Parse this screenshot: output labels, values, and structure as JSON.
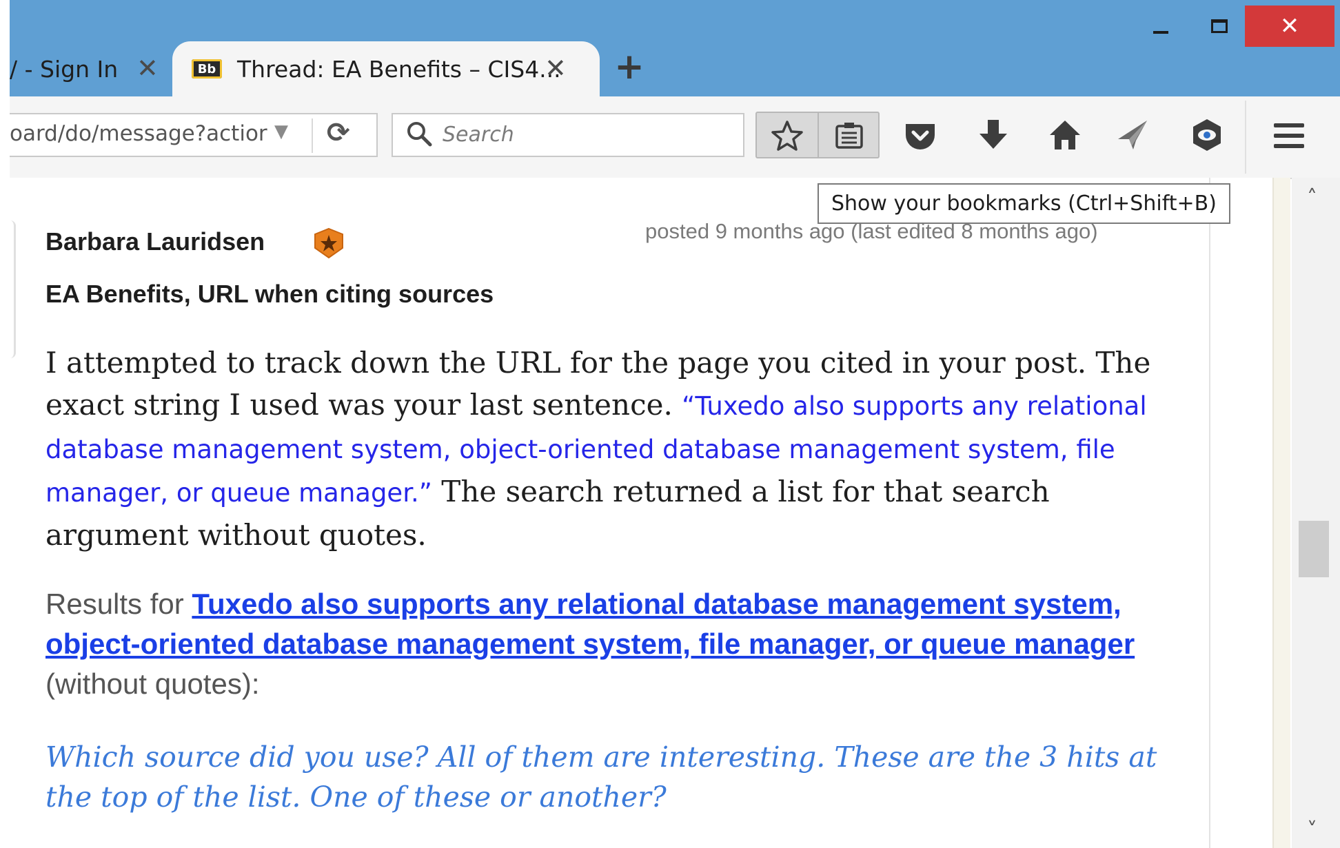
{
  "window": {
    "minimize_label": "–",
    "maximize_label": "☐",
    "close_label": "✕"
  },
  "tabs": [
    {
      "label": "/ - Sign In",
      "close": "✕"
    },
    {
      "label": "Thread: EA Benefits – CIS4...",
      "favicon": "Bb",
      "close": "✕"
    }
  ],
  "new_tab_label": "+",
  "navbar": {
    "url": "oard/do/message?actior",
    "search_placeholder": "Search",
    "icons": [
      "star-icon",
      "bookmarks-icon",
      "pocket-icon",
      "download-icon",
      "home-icon",
      "send-icon",
      "privacy-icon",
      "menu-icon"
    ]
  },
  "tooltip": "Show your bookmarks (Ctrl+Shift+B)",
  "post": {
    "author": "Barbara Lauridsen",
    "posted": "posted 9 months ago (last edited 8 months ago)",
    "subject": "EA Benefits, URL when citing sources",
    "body_intro": "I attempted to track down the URL for the page you cited in your post. The exact string I used was your last sentence. ",
    "body_quote": "“Tuxedo also supports any relational database management system, object-oriented database management system, file manager, or queue manager.”",
    "body_outro": " The search returned a list for that search argument without quotes.",
    "results_prefix": "Results for ",
    "results_link": "Tuxedo also supports any relational database management system, object-oriented database management system, file manager, or queue manager",
    "results_suffix": " (without quotes):",
    "question": "Which source did you use? All of them are interesting. These are the 3 hits at the top of the list. One of these or another?"
  },
  "colors": {
    "titlebar": "#5f9fd3",
    "close_button": "#d3393a",
    "quote_text": "#2525e8",
    "link": "#1a3fe6",
    "question_text": "#3b7ad9"
  }
}
